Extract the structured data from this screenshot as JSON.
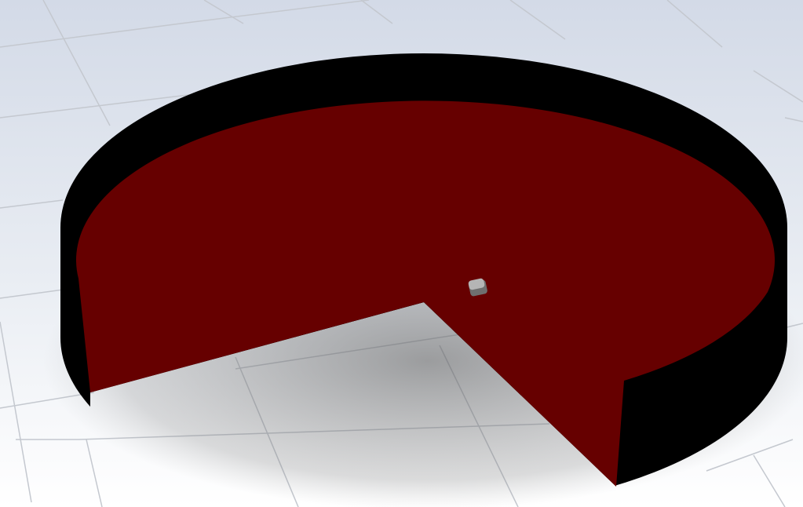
{
  "scene": {
    "colors": {
      "background_top": "#d3dae7",
      "background_bottom": "#ffffff",
      "grid": "#c4c8cf",
      "wall": "#000000",
      "floor_face": "#660000",
      "part": "#9a9a9a"
    },
    "objects": [
      "cylindrical-shell-with-cutout",
      "small-part"
    ]
  }
}
